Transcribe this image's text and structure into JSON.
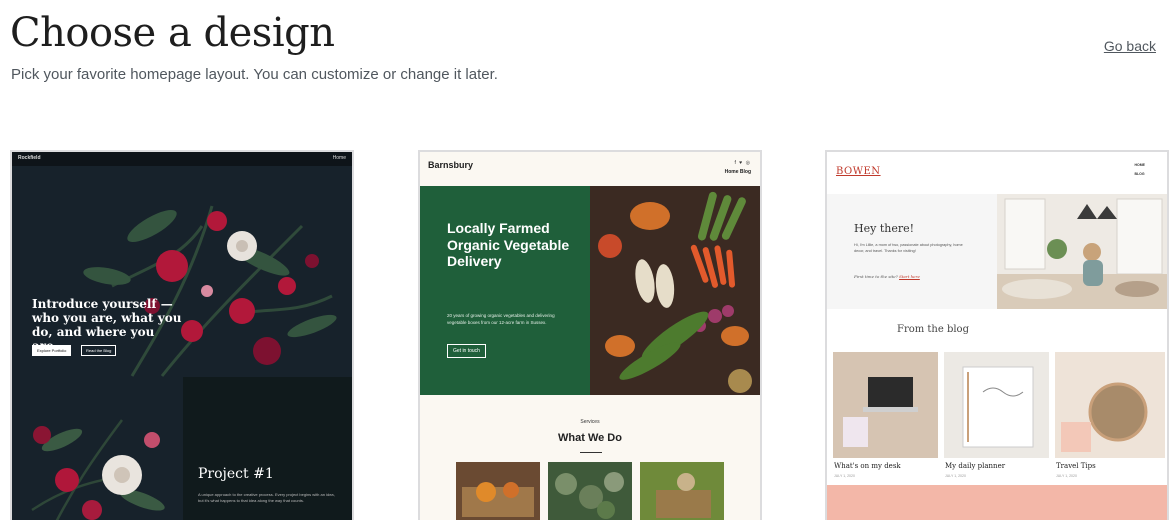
{
  "header": {
    "title": "Choose a design",
    "subtitle": "Pick your favorite homepage layout. You can customize or change it later.",
    "go_back": "Go back"
  },
  "designs": [
    {
      "nav": {
        "brand": "Rockfield",
        "home": "Home"
      },
      "heading": "Introduce yourself — who you are, what you do, and where you are.",
      "buttons": [
        "Explore Portfolio",
        "Read the Blog"
      ],
      "project_title": "Project #1",
      "project_text": "A unique approach to the creative process. Every project begins with an idea, but it's what happens to that idea along the way that counts."
    },
    {
      "brand": "Barnsbury",
      "social_icons": [
        "facebook-icon",
        "twitter-icon",
        "instagram-icon"
      ],
      "social_glyphs": "f ♥ ◎",
      "nav": "Home  Blog",
      "hero_title": "Locally Farmed Organic Vegetable Delivery",
      "hero_text": "20 years of growing organic vegetables and delivering vegetable boxes from our 12-acre farm in Sussex.",
      "cta": "Get in touch",
      "section_kicker": "Services",
      "section_title": "What We Do"
    },
    {
      "brand": "BOWEN",
      "nav": [
        "HOME",
        "BLOG"
      ],
      "intro_title": "Hey there!",
      "intro_text": "Hi, I'm Lillie, a mom of two, passionate about photography, home decor, and travel. Thanks for visiting!",
      "intro_link_prefix": "First time to the site?",
      "intro_link": "Start here",
      "blog_title": "From the blog",
      "posts": [
        {
          "title": "What's on my desk",
          "date": "JULY 1, 2020"
        },
        {
          "title": "My daily planner",
          "date": "JULY 1, 2020"
        },
        {
          "title": "Travel Tips",
          "date": "JULY 1, 2020"
        }
      ]
    }
  ]
}
